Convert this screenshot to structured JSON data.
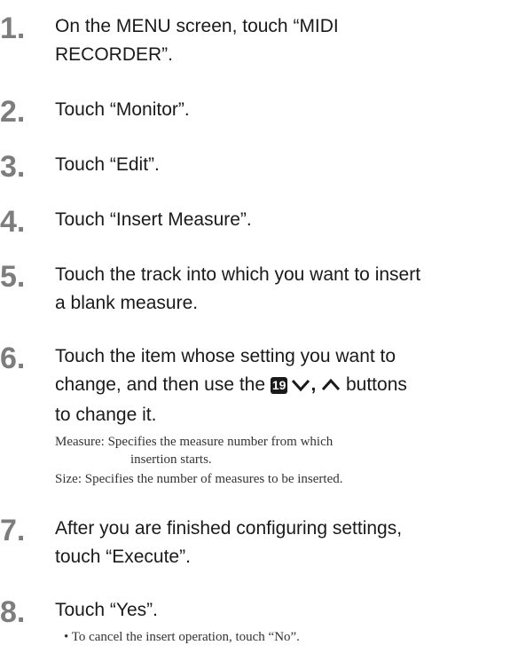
{
  "steps": [
    {
      "num": "1",
      "dot": ".",
      "line1": "On the MENU screen, touch “MIDI",
      "line2": "RECORDER”."
    },
    {
      "num": "2",
      "dot": ".",
      "text": "Touch “Monitor”."
    },
    {
      "num": "3",
      "dot": ".",
      "text": "Touch “Edit”."
    },
    {
      "num": "4",
      "dot": ".",
      "text": "Touch “Insert Measure”."
    },
    {
      "num": "5",
      "dot": ".",
      "line1": "Touch the track into which you want to insert",
      "line2": "a blank measure."
    },
    {
      "num": "6",
      "dot": ".",
      "line1": "Touch the item whose setting you want to",
      "line2_pre": "change, and then use the",
      "button_number": "19",
      "comma": ",",
      "line2_post": "buttons",
      "line3": "to change it.",
      "notes": [
        {
          "label": "Measure:",
          "text": "Specifies the measure number from which",
          "cont": "insertion starts."
        },
        {
          "label": "Size:",
          "text": "Specifies the number of measures to be inserted."
        }
      ]
    },
    {
      "num": "7",
      "dot": ".",
      "line1": "After you are finished configuring settings,",
      "line2": "touch “Execute”."
    },
    {
      "num": "8",
      "dot": ".",
      "text": "Touch “Yes”.",
      "bullet_symbol": "•",
      "bullet": "To cancel the insert operation, touch “No”."
    }
  ],
  "icons": {
    "down": "chevron-down-icon",
    "up": "chevron-up-icon"
  }
}
